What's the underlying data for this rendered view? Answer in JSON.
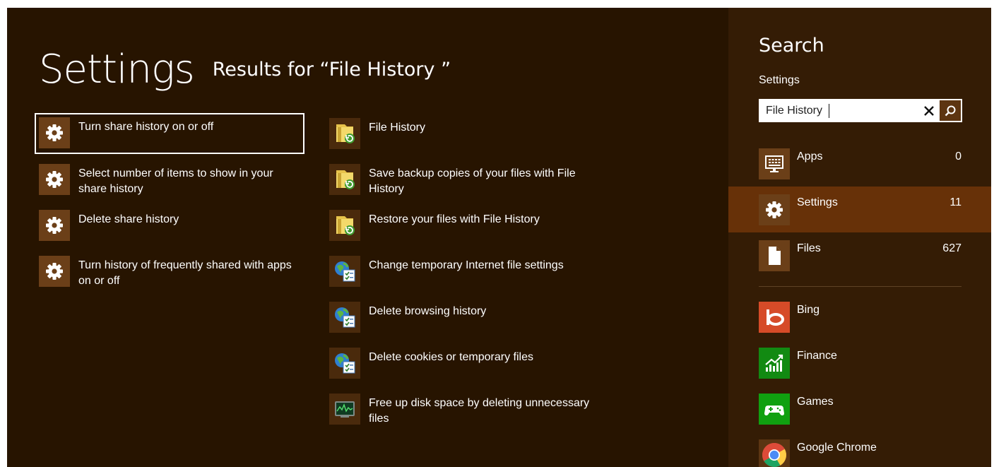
{
  "heading": {
    "title": "Settings",
    "results_for": "Results for “File History ”"
  },
  "results": {
    "col1": [
      {
        "label": "Turn share history on or off",
        "icon": "gear-icon",
        "selected": true
      },
      {
        "label": "Select number of items to show in your share history",
        "icon": "gear-icon"
      },
      {
        "label": "Delete share history",
        "icon": "gear-icon"
      },
      {
        "label": "Turn history of frequently shared with apps on or off",
        "icon": "gear-icon"
      }
    ],
    "col2": [
      {
        "label": "File History",
        "icon": "file-history-icon"
      },
      {
        "label": "Save backup copies of your files with File History",
        "icon": "file-history-icon"
      },
      {
        "label": "Restore your files with File History",
        "icon": "file-history-icon"
      },
      {
        "label": "Change temporary Internet file settings",
        "icon": "internet-options-icon"
      },
      {
        "label": "Delete browsing history",
        "icon": "internet-options-icon"
      },
      {
        "label": "Delete cookies or temporary files",
        "icon": "internet-options-icon"
      },
      {
        "label": "Free up disk space by deleting unnecessary files",
        "icon": "disk-cleanup-icon"
      }
    ]
  },
  "search": {
    "title": "Search",
    "scope": "Settings",
    "query": "File History",
    "categories": [
      {
        "name": "Apps",
        "count": "0",
        "icon": "apps-icon"
      },
      {
        "name": "Settings",
        "count": "11",
        "icon": "gear-icon",
        "active": true
      },
      {
        "name": "Files",
        "count": "627",
        "icon": "file-icon"
      }
    ],
    "apps": [
      {
        "name": "Bing",
        "icon": "bing-icon",
        "color": "#d64b28"
      },
      {
        "name": "Finance",
        "icon": "finance-icon",
        "color": "#128a12"
      },
      {
        "name": "Games",
        "icon": "games-icon",
        "color": "#10a010"
      },
      {
        "name": "Google Chrome",
        "icon": "chrome-icon",
        "color": "#5b3512"
      }
    ]
  },
  "colors": {
    "background": "#271400",
    "pane": "#341c05",
    "active_category": "#673108",
    "tile": "#6b3f18"
  }
}
